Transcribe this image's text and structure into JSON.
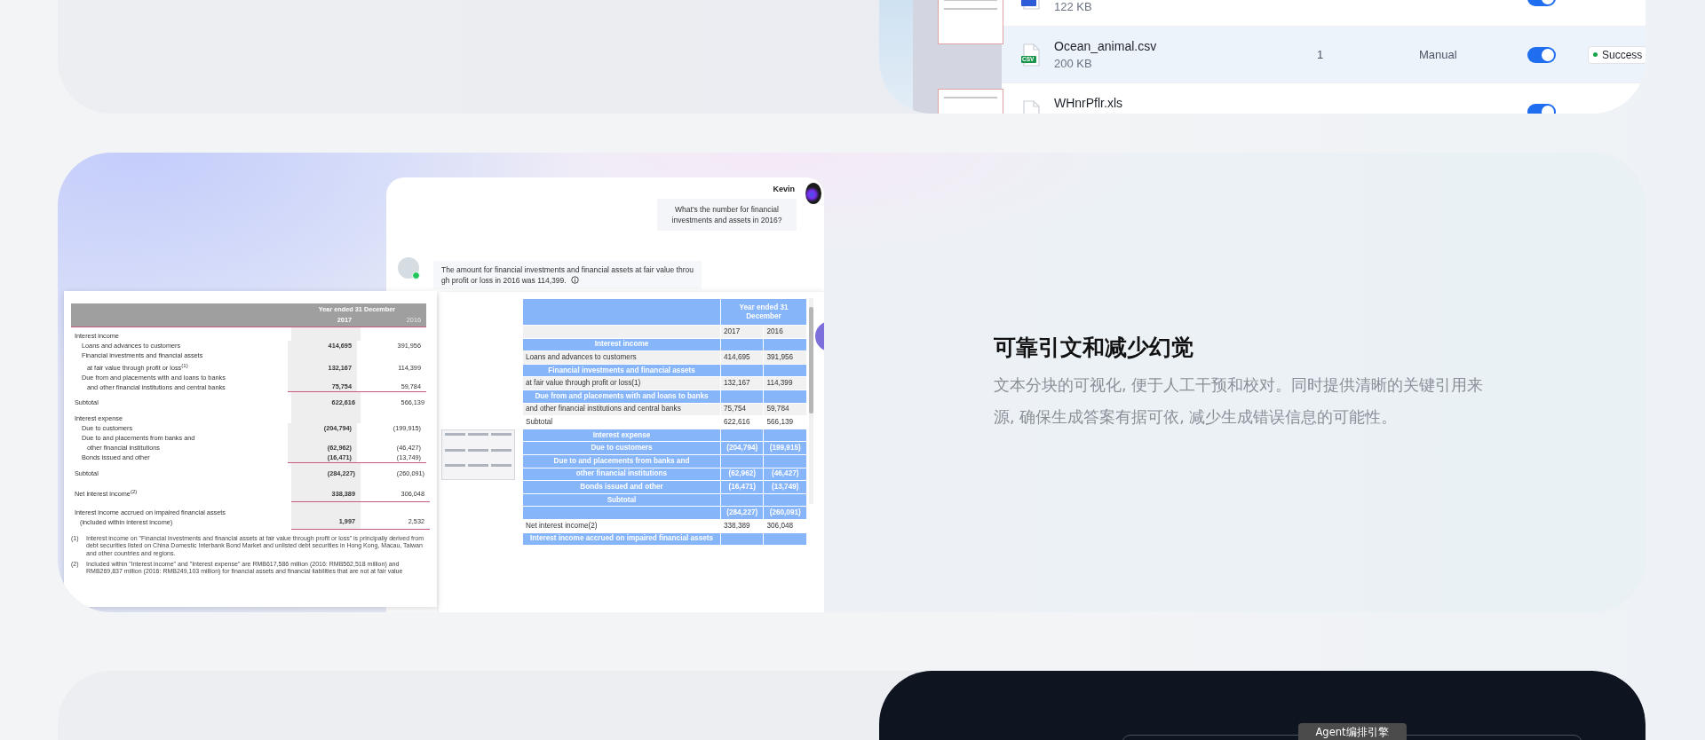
{
  "file_table": {
    "rows": [
      {
        "color": "#2d5bd7",
        "size": "122 KB",
        "enabled": true,
        "selected": false
      },
      {
        "tag": "CSV",
        "color": "#17934a",
        "name": "Ocean_animal.csv",
        "size": "200 KB",
        "count": "1",
        "mode": "Manual",
        "enabled": true,
        "status": "Success",
        "selected": true
      },
      {
        "name": "WHnrPflr.xls",
        "enabled": true,
        "selected": false
      }
    ]
  },
  "chat": {
    "user": "Kevin",
    "question": "What's the number for financial investments and assets in 2016?",
    "answer": "The amount for financial investments and financial assets at fair value through profit or loss in 2016 was 114,399."
  },
  "source_document": {
    "header": "Year ended 31 December",
    "years": [
      "2017",
      "2016"
    ],
    "rows": [
      {
        "kind": "heading",
        "lines": [
          "Interest income"
        ]
      },
      {
        "kind": "item",
        "lines": [
          "Loans and advances to customers"
        ],
        "values": [
          "414,695",
          "391,956"
        ]
      },
      {
        "kind": "item",
        "lines": [
          "Financial investments and financial assets",
          "at fair value through profit or loss$^{(1)}$"
        ],
        "values": [
          "132,167",
          "114,399"
        ]
      },
      {
        "kind": "item",
        "lines": [
          "Due from and placements with and loans to banks",
          "and other financial institutions and central banks"
        ],
        "values": [
          "75,754",
          "59,784"
        ],
        "rule_below": true
      },
      {
        "kind": "total",
        "lines": [
          "Subtotal"
        ],
        "values": [
          "622,616",
          "566,139"
        ]
      },
      {
        "kind": "heading",
        "lines": [
          "Interest expense"
        ]
      },
      {
        "kind": "item",
        "lines": [
          "Due to customers"
        ],
        "values": [
          "(204,794)",
          "(199,915)"
        ]
      },
      {
        "kind": "item",
        "lines": [
          "Due to and placements from banks and",
          "other financial institutions"
        ],
        "values": [
          "(62,962)",
          "(46,427)"
        ]
      },
      {
        "kind": "item",
        "lines": [
          "Bonds issued and other"
        ],
        "values": [
          "(16,471)",
          "(13,749)"
        ],
        "rule_below": true
      },
      {
        "kind": "total",
        "lines": [
          "Subtotal"
        ],
        "values": [
          "(284,227)",
          "(260,091)"
        ]
      },
      {
        "kind": "total",
        "lines": [
          "Net interest income$^{(2)}$"
        ],
        "values": [
          "338,389",
          "306,048"
        ],
        "rule_below": true
      },
      {
        "kind": "total",
        "lines": [
          "Interest income accrued on impaired financial assets",
          "(included within interest income)"
        ],
        "values": [
          "1,997",
          "2,532"
        ],
        "rule_below": true
      }
    ],
    "footnotes": [
      {
        "mark": "(1)",
        "text": "Interest income on \"Financial investments and financial assets at fair value through profit or loss\" is principally derived from debt securities listed on China Domestic Interbank Bond Market and unlisted debt securities in Hong Kong, Macau, Taiwan and other countries and regions."
      },
      {
        "mark": "(2)",
        "text": "Included within \"Interest income\" and \"Interest expense\" are RMB617,586 million (2016: RMB562,518 million) and RMB269,837 million (2016: RMB249,103 million) for financial assets and financial liabilities that are not at fair value"
      }
    ]
  },
  "parsed_table": {
    "header": "Year ended 31 December",
    "years": [
      "2017",
      "2016"
    ],
    "rows": [
      {
        "kind": "band",
        "label": "Interest income"
      },
      {
        "kind": "shaded",
        "label": "Loans and advances to customers",
        "values": [
          "414,695",
          "391,956"
        ]
      },
      {
        "kind": "band",
        "label": "Financial investments and financial assets"
      },
      {
        "kind": "shaded",
        "label": "at fair value through profit or loss(1)",
        "values": [
          "132,167",
          "114,399"
        ]
      },
      {
        "kind": "band",
        "label": "Due from and placements with and loans to banks"
      },
      {
        "kind": "shaded",
        "label": "and other financial institutions and central banks",
        "values": [
          "75,754",
          "59,784"
        ]
      },
      {
        "kind": "plain",
        "label": "Subtotal",
        "values": [
          "622,616",
          "566,139"
        ]
      },
      {
        "kind": "band",
        "label": "Interest expense"
      },
      {
        "kind": "band",
        "label": "Due to customers",
        "values": [
          "(204,794)",
          "(199,915)"
        ]
      },
      {
        "kind": "band",
        "label": "Due to and placements from banks and"
      },
      {
        "kind": "band",
        "label": "other financial institutions",
        "values": [
          "(62,962)",
          "(46,427)"
        ]
      },
      {
        "kind": "band",
        "label": "Bonds issued and other",
        "values": [
          "(16,471)",
          "(13,749)"
        ]
      },
      {
        "kind": "band",
        "label": "Subtotal"
      },
      {
        "kind": "band",
        "values": [
          "(284,227)",
          "(260,091)"
        ]
      },
      {
        "kind": "plain",
        "label": "Net interest income(2)",
        "values": [
          "338,389",
          "306,048"
        ]
      },
      {
        "kind": "band",
        "label": "Interest income accrued on impaired financial assets"
      }
    ]
  },
  "feature": {
    "title": "可靠引文和减少幻觉",
    "description": "文本分块的可视化, 便于人工干预和校对。同时提供清晰的关键引用来源, 确保生成答案有据可依, 减少生成错误信息的可能性。"
  },
  "bottom_panel": {
    "tab": "Agent编排引擎"
  }
}
